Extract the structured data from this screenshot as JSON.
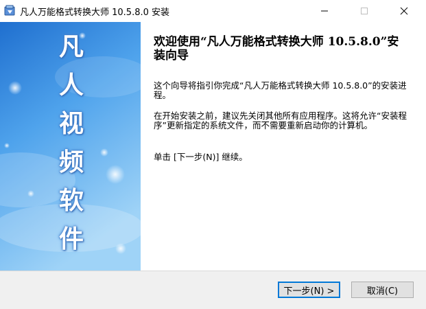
{
  "window": {
    "title": "凡人万能格式转换大师 10.5.8.0 安装",
    "app_icon": "installer-icon",
    "controls": [
      "minimize-icon",
      "maximize-icon",
      "close-icon"
    ]
  },
  "banner": {
    "chars": [
      "凡",
      "人",
      "视",
      "频",
      "软",
      "件"
    ],
    "colors": {
      "top": "#1f6fcf",
      "mid": "#4fa3ec",
      "bottom": "#9fd3f7"
    }
  },
  "content": {
    "heading": "欢迎使用“凡人万能格式转换大师 10.5.8.0”安装向导",
    "para1": "这个向导将指引你完成“凡人万能格式转换大师 10.5.8.0”的安装进程。",
    "para2": "在开始安装之前，建议先关闭其他所有应用程序。这将允许“安装程序”更新指定的系统文件，而不需要重新启动你的计算机。",
    "para3": "单击 [下一步(N)] 继续。"
  },
  "footer": {
    "next_label": "下一步(N) >",
    "cancel_label": "取消(C)",
    "accent": "#0078d7"
  }
}
